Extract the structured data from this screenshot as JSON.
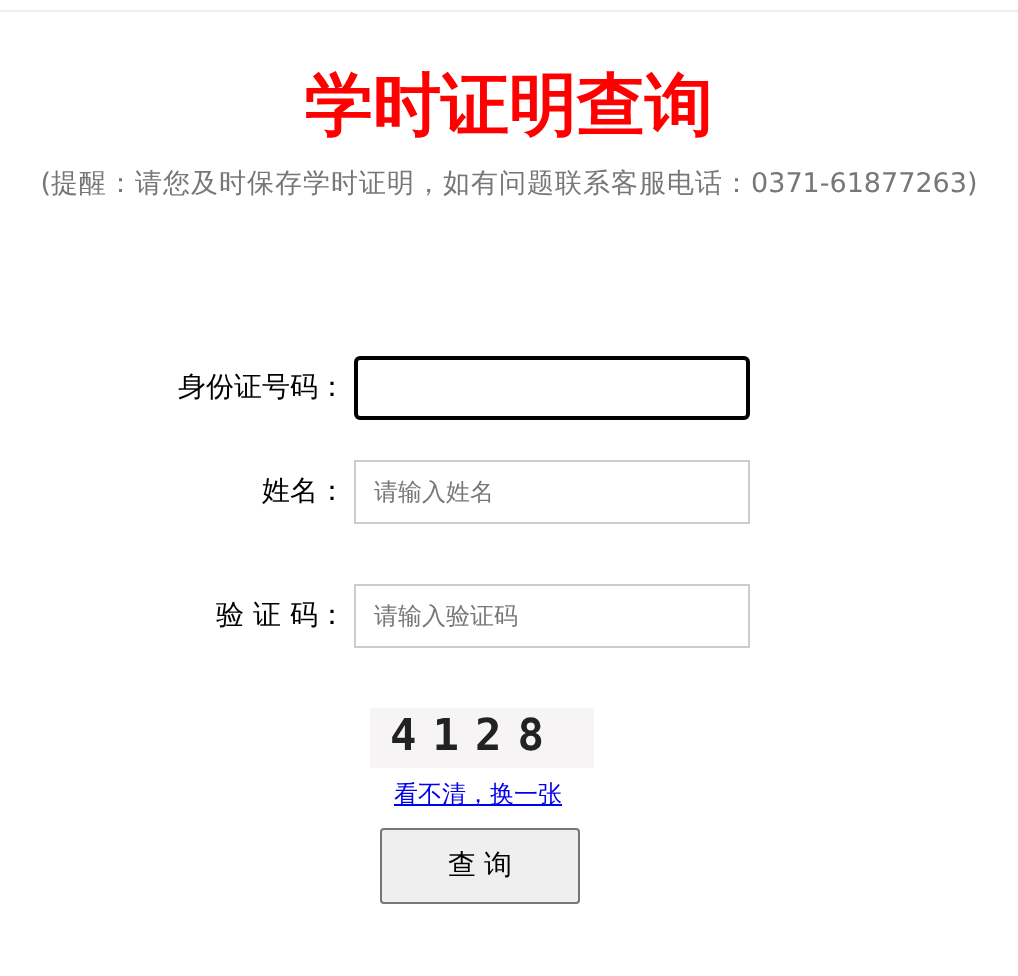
{
  "title": "学时证明查询",
  "notice": "(提醒：请您及时保存学时证明，如有问题联系客服电话：0371-61877263)",
  "fields": [
    {
      "label": "身份证号码：",
      "focused": true
    },
    {
      "label": "姓名：",
      "placeholder": "请输入姓名",
      "focused": false
    },
    {
      "label": "验 证 码：",
      "placeholder": "请输入验证码",
      "focused": false
    }
  ],
  "captcha": {
    "text": "4128",
    "refresh_link": "看不清，换一张"
  },
  "submit_button": "查 询"
}
